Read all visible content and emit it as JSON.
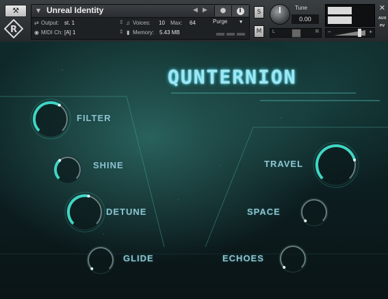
{
  "header": {
    "instrument_name": "Unreal Identity",
    "output_label": "Output:",
    "output_value": "st. 1",
    "voices_label": "Voices:",
    "voices_value": "10",
    "max_label": "Max:",
    "max_value": "64",
    "midi_label": "MIDI Ch:",
    "midi_value": "[A]  1",
    "memory_label": "Memory:",
    "memory_value": "5.43 MB",
    "purge_label": "Purge",
    "solo_label": "S",
    "mute_label": "M",
    "tune_label": "Tune",
    "tune_value": "0.00",
    "pan_left": "L",
    "pan_right": "R",
    "aux_label": "AUX",
    "pv_label": "PV",
    "vol_minus": "−",
    "vol_plus": "+"
  },
  "instrument": {
    "brand": "QUNTERNION",
    "accent_color": "#3fd6c4",
    "knobs": [
      {
        "id": "filter",
        "label": "FILTER",
        "value": 0.62,
        "active": true
      },
      {
        "id": "shine",
        "label": "SHINE",
        "value": 0.35,
        "active": false
      },
      {
        "id": "detune",
        "label": "DETUNE",
        "value": 0.55,
        "active": true
      },
      {
        "id": "glide",
        "label": "GLIDE",
        "value": 0.0,
        "active": false
      },
      {
        "id": "travel",
        "label": "TRAVEL",
        "value": 0.78,
        "active": true
      },
      {
        "id": "space",
        "label": "SPACE",
        "value": 0.0,
        "active": false
      },
      {
        "id": "echoes",
        "label": "ECHOES",
        "value": 0.0,
        "active": false
      }
    ]
  }
}
